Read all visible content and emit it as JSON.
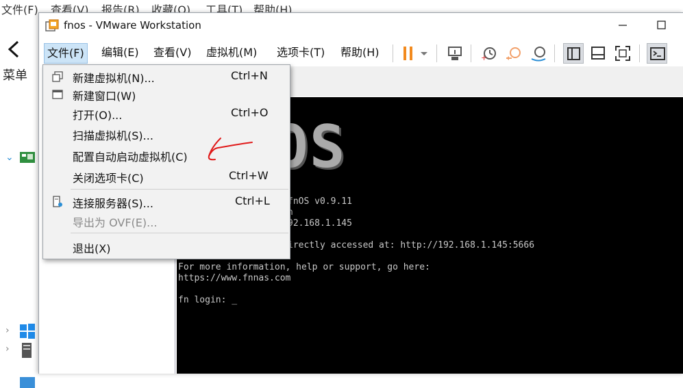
{
  "background_app": {
    "menu": [
      "文件(F)",
      "查看(V)",
      "报告(R)",
      "收藏(O)",
      "工具(T)",
      "帮助(H)"
    ],
    "side_label": "菜单"
  },
  "window": {
    "title": "fnos - VMware Workstation"
  },
  "menubar": {
    "items": [
      "文件(F)",
      "编辑(E)",
      "查看(V)",
      "虚拟机(M)",
      "选项卡(T)",
      "帮助(H)"
    ]
  },
  "toolbar": {
    "icons": [
      "pause-icon",
      "dropdown-arrow-icon",
      "send-keys-icon",
      "snapshot-icon",
      "revert-snapshot-icon",
      "snapshot-manager-icon",
      "library-view-icon",
      "thumbnail-view-icon",
      "fullscreen-icon",
      "console-icon"
    ],
    "accent_color": "#f28a1e"
  },
  "file_menu": {
    "items": [
      {
        "label": "新建虚拟机(N)...",
        "shortcut": "Ctrl+N"
      },
      {
        "label": "新建窗口(W)",
        "shortcut": ""
      },
      {
        "label": "打开(O)...",
        "shortcut": "Ctrl+O"
      },
      {
        "label": "扫描虚拟机(S)...",
        "shortcut": ""
      },
      {
        "label": "配置自动启动虚拟机(C)",
        "shortcut": ""
      },
      {
        "label": "关闭选项卡(C)",
        "shortcut": "Ctrl+W"
      },
      {
        "label": "连接服务器(S)...",
        "shortcut": "Ctrl+L"
      },
      {
        "label": "导出为 OVF(E)...",
        "shortcut": "",
        "disabled": true
      },
      {
        "label": "退出(X)",
        "shortcut": ""
      }
    ]
  },
  "console": {
    "logo": "OS",
    "lines": [
      "fnOS v0.9.11",
      "n",
      "92.168.1.145",
      "irectly accessed at: http://192.168.1.145:5666",
      "For more information, help or support, go here:",
      "https://www.fnnas.com",
      "fn login: _"
    ]
  }
}
